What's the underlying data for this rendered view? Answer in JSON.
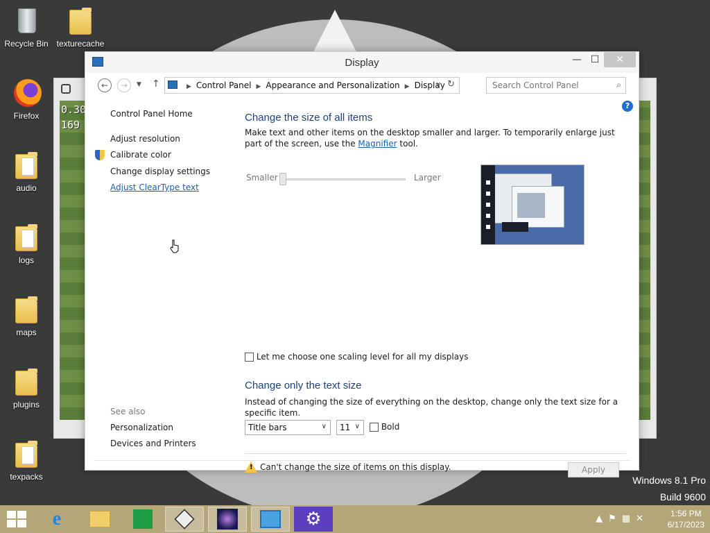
{
  "desktop": {
    "icons": [
      {
        "label": "Recycle Bin"
      },
      {
        "label": "texturecache"
      },
      {
        "label": "Firefox"
      },
      {
        "label": "audio"
      },
      {
        "label": "logs"
      },
      {
        "label": "maps"
      },
      {
        "label": "plugins"
      },
      {
        "label": "texpacks"
      }
    ],
    "watermark": {
      "line1": "Windows 8.1 Pro",
      "line2": "Build 9600"
    }
  },
  "background_window": {
    "text_line1": "0.30",
    "text_line2": "169"
  },
  "window": {
    "title": "Display",
    "controls": {
      "minimize": "—",
      "maximize": "☐",
      "close": "✕"
    },
    "address": {
      "crumbs": [
        "Control Panel",
        "Appearance and Personalization",
        "Display"
      ]
    },
    "search": {
      "placeholder": "Search Control Panel"
    },
    "help_label": "?"
  },
  "sidebar": {
    "home": "Control Panel Home",
    "links": [
      {
        "label": "Adjust resolution"
      },
      {
        "label": "Calibrate color"
      },
      {
        "label": "Change display settings"
      },
      {
        "label": "Adjust ClearType text"
      }
    ],
    "see_also_heading": "See also",
    "see_also": [
      {
        "label": "Personalization"
      },
      {
        "label": "Devices and Printers"
      }
    ]
  },
  "main": {
    "size_section": {
      "heading": "Change the size of all items",
      "desc_before": "Make text and other items on the desktop smaller and larger. To temporarily enlarge just part of the screen, use the ",
      "desc_link": "Magnifier",
      "desc_after": " tool.",
      "slider_min_label": "Smaller",
      "slider_max_label": "Larger",
      "slider_level": 0
    },
    "scaling_checkbox": {
      "label": "Let me choose one scaling level for all my displays",
      "checked": false
    },
    "text_section": {
      "heading": "Change only the text size",
      "desc": "Instead of changing the size of everything on the desktop, change only the text size for a specific item.",
      "item_select": "Title bars",
      "size_select": "11",
      "bold_label": "Bold",
      "bold_checked": false
    },
    "warning": "Can't change the size of items on this display.",
    "apply_label": "Apply"
  },
  "taskbar": {
    "clock": {
      "time": "1:56 PM",
      "date": "6/17/2023"
    },
    "tray_icons": [
      "chevron-up-icon",
      "flag-icon",
      "network-icon",
      "speaker-muted-icon"
    ]
  },
  "colors": {
    "heading_blue": "#1e3f7a",
    "link_blue": "#1a5fb4",
    "taskbar": "#b5a67a"
  }
}
